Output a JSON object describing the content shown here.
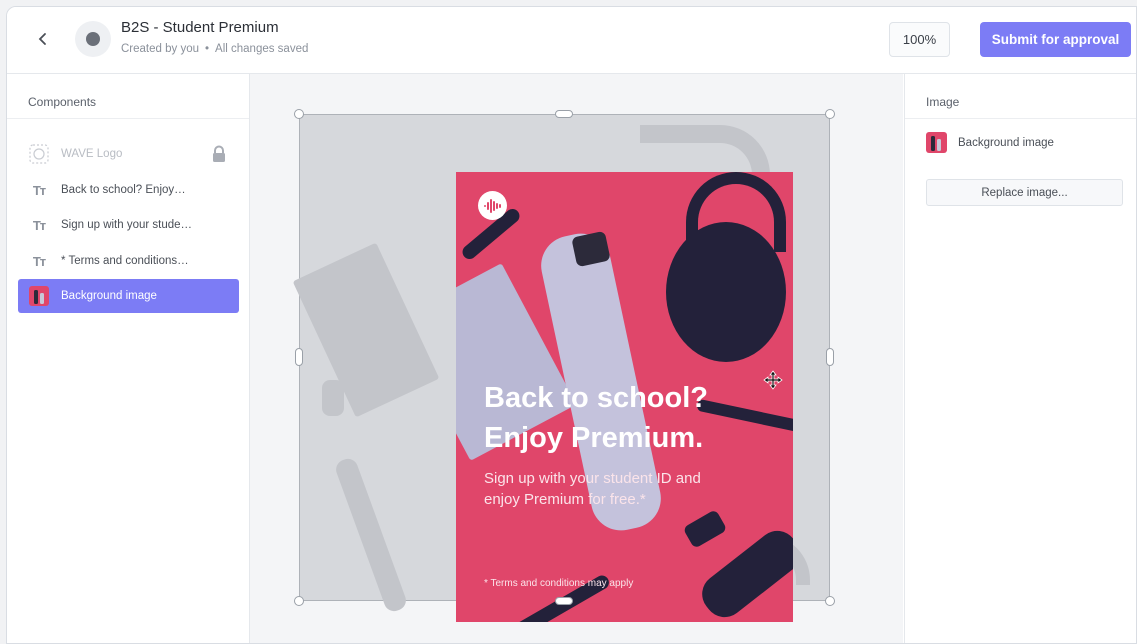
{
  "header": {
    "title": "B2S - Student Premium",
    "created_by": "Created by you",
    "separator": "•",
    "save_status": "All changes saved",
    "zoom": "100%",
    "submit_label": "Submit for approval"
  },
  "components_panel": {
    "heading": "Components",
    "items": [
      {
        "label": "WAVE Logo",
        "icon": "logo-icon",
        "locked": true,
        "disabled": true
      },
      {
        "label": "Back to school? Enjoy…",
        "icon": "text-icon"
      },
      {
        "label": "Sign up with your stude…",
        "icon": "text-icon"
      },
      {
        "label": "* Terms and conditions…",
        "icon": "text-icon"
      },
      {
        "label": "Background image",
        "icon": "image-thumbnail",
        "active": true
      }
    ],
    "text_icon_glyph": "Tт"
  },
  "poster": {
    "headline_line1": "Back to school?",
    "headline_line2": "Enjoy Premium.",
    "body_line1": "Sign up with your student ID and",
    "body_line2": "enjoy Premium for free.*",
    "terms": "* Terms and conditions may apply",
    "background_color": "#e0466a"
  },
  "image_panel": {
    "heading": "Image",
    "item_label": "Background image",
    "replace_label": "Replace image..."
  },
  "colors": {
    "accent": "#7c7cf5",
    "poster_pink": "#e0466a"
  }
}
